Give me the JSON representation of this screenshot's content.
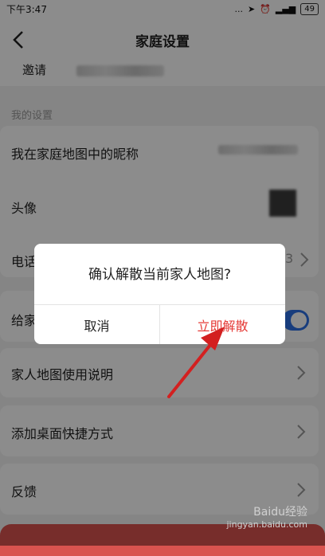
{
  "status": {
    "time": "下午3:47",
    "signal": "...",
    "battery": "49"
  },
  "nav": {
    "title": "家庭设置"
  },
  "invite": {
    "label": "邀请"
  },
  "settings": {
    "section_title": "我的设置",
    "nickname_label": "我在家庭地图中的昵称",
    "avatar_label": "头像",
    "phone_label": "电话",
    "phone_suffix": "3",
    "send_label": "给家",
    "guide_label": "家人地图使用说明",
    "shortcut_label": "添加桌面快捷方式",
    "feedback_label": "反馈"
  },
  "dialog": {
    "message": "确认解散当前家人地图?",
    "cancel": "取消",
    "confirm": "立即解散"
  },
  "watermark": {
    "main": "Baidu经验",
    "sub": "jingyan.baidu.com"
  },
  "colors": {
    "accent": "#2d6fe3",
    "danger": "#e53935"
  }
}
